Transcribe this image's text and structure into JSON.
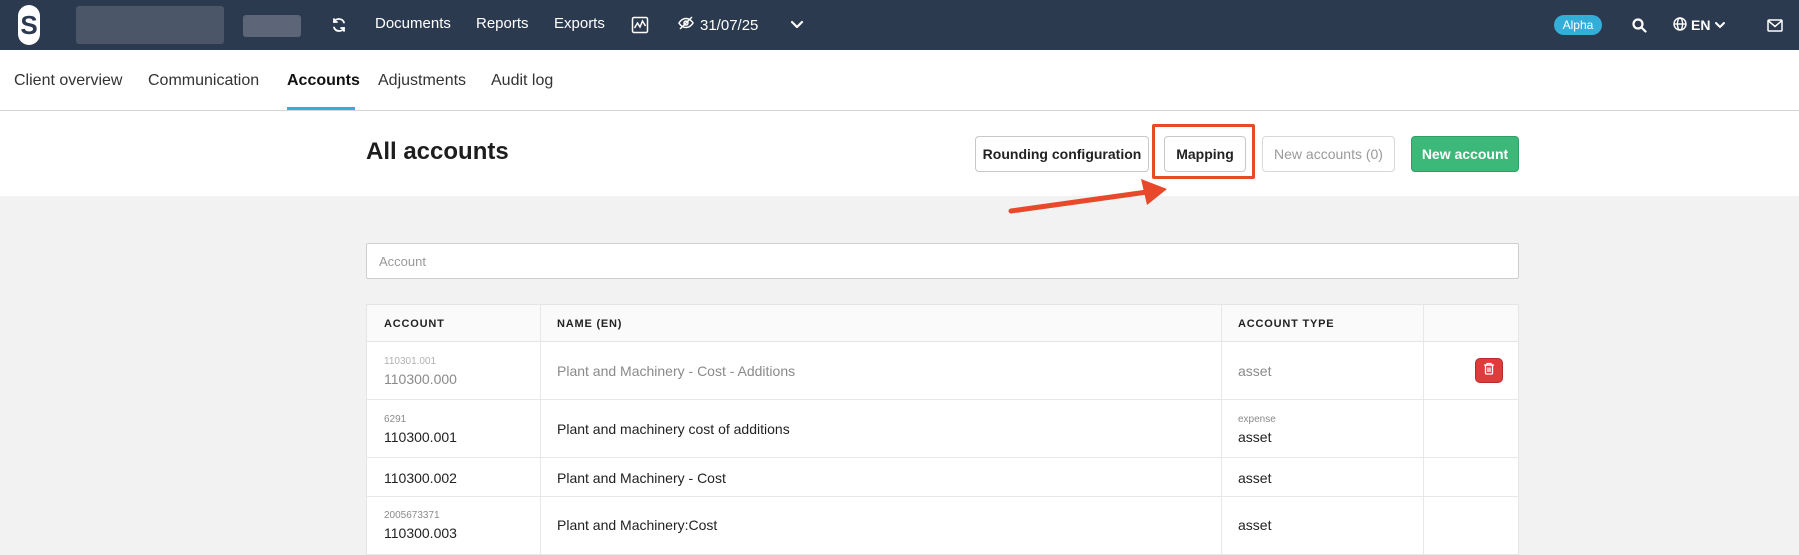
{
  "topbar": {
    "logo_letter": "S",
    "nav": [
      "Documents",
      "Reports",
      "Exports"
    ],
    "date": "31/07/25",
    "badge": "Alpha",
    "language": "EN",
    "icons": {
      "refresh": "refresh-icon",
      "chart": "activity-chart-icon",
      "eye": "eye-slash-icon",
      "chevron": "chevron-down-icon",
      "search": "search-icon",
      "globe": "globe-icon",
      "mail": "mail-icon"
    }
  },
  "tabs": [
    {
      "label": "Client overview",
      "active": false
    },
    {
      "label": "Communication",
      "active": false
    },
    {
      "label": "Accounts",
      "active": true
    },
    {
      "label": "Adjustments",
      "active": false
    },
    {
      "label": "Audit log",
      "active": false
    }
  ],
  "header": {
    "title": "All accounts",
    "buttons": {
      "rounding": "Rounding configuration",
      "mapping": "Mapping",
      "new_accounts": "New accounts (0)",
      "new_account": "New account"
    }
  },
  "search": {
    "placeholder": "Account",
    "value": ""
  },
  "table": {
    "columns": [
      "ACCOUNT",
      "NAME (EN)",
      "ACCOUNT TYPE",
      ""
    ],
    "rows": [
      {
        "sub_account": "110301.001",
        "account": "110300.000",
        "name": "Plant and Machinery - Cost - Additions",
        "sub_type": "",
        "type": "asset",
        "muted": true,
        "deletable": true
      },
      {
        "sub_account": "6291",
        "account": "110300.001",
        "name": "Plant and machinery cost of additions",
        "sub_type": "expense",
        "type": "asset",
        "muted": false,
        "deletable": false
      },
      {
        "sub_account": "",
        "account": "110300.002",
        "name": "Plant and Machinery - Cost",
        "sub_type": "",
        "type": "asset",
        "muted": false,
        "deletable": false
      },
      {
        "sub_account": "2005673371",
        "account": "110300.003",
        "name": "Plant and Machinery:Cost",
        "sub_type": "",
        "type": "asset",
        "muted": false,
        "deletable": false
      }
    ]
  },
  "colors": {
    "topbar": "#2c3a4f",
    "accent": "#33aed9",
    "primary_button": "#3cb878",
    "danger": "#e03b3b",
    "annotation": "#e8492a"
  }
}
